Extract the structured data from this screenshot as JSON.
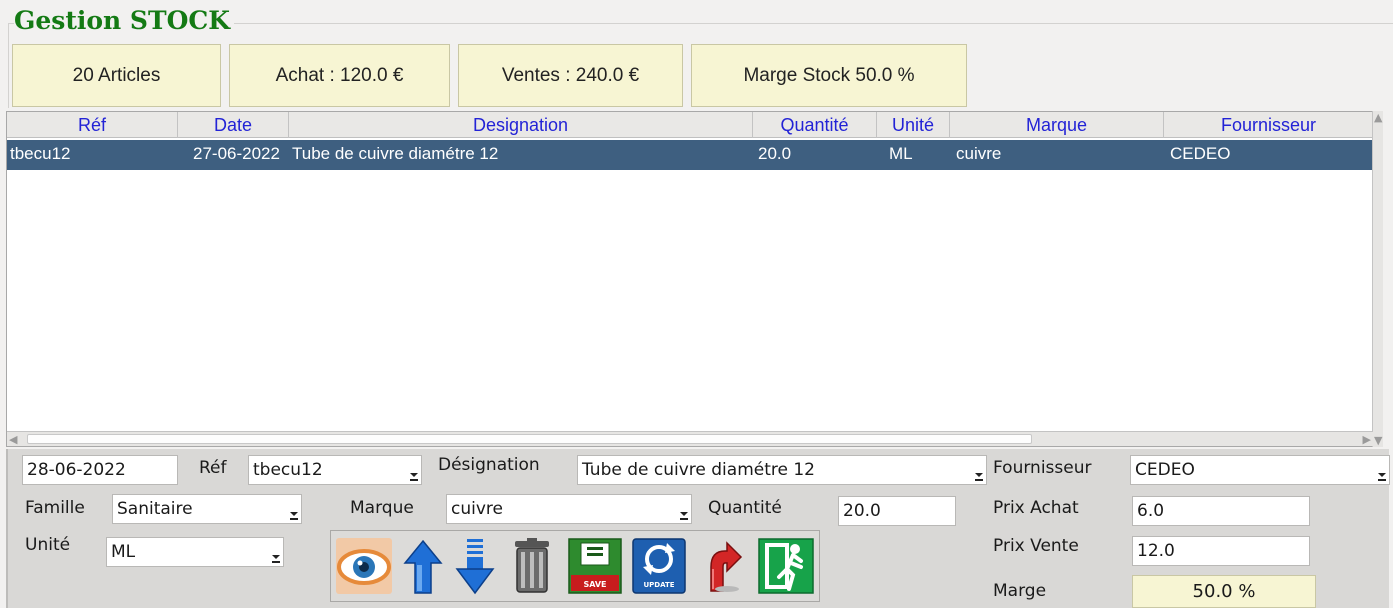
{
  "title": "Gestion STOCK",
  "stats": {
    "articles": "20 Articles",
    "achat": "Achat : 120.0 €",
    "ventes": "Ventes : 240.0 €",
    "marge": "Marge Stock 50.0 %"
  },
  "table": {
    "columns": [
      "Réf",
      "Date",
      "Designation",
      "Quantité",
      "Unité",
      "Marque",
      "Fournisseur"
    ],
    "rows": [
      {
        "ref": "tbecu12",
        "date": "27-06-2022",
        "designation": "Tube de cuivre diamétre 12",
        "quantite": "20.0",
        "unite": "ML",
        "marque": "cuivre",
        "fournisseur": "CEDEO"
      }
    ]
  },
  "form": {
    "date": "28-06-2022",
    "ref_label": "Réf",
    "ref": "tbecu12",
    "designation_label": "Désignation",
    "designation": "Tube de cuivre diamétre 12",
    "fournisseur_label": "Fournisseur",
    "fournisseur": "CEDEO",
    "famille_label": "Famille",
    "famille": "Sanitaire",
    "marque_label": "Marque",
    "marque": "cuivre",
    "quantite_label": "Quantité",
    "quantite": "20.0",
    "prix_achat_label": "Prix Achat",
    "prix_achat": "6.0",
    "unite_label": "Unité",
    "unite": "ML",
    "prix_vente_label": "Prix Vente",
    "prix_vente": "12.0",
    "marge_label": "Marge",
    "marge": "50.0 %"
  },
  "toolbar": {
    "save_caption": "SAVE",
    "update_caption": "UPDATE",
    "icons": [
      "eye-icon",
      "arrow-up-icon",
      "arrow-down-icon",
      "trash-icon",
      "save-icon",
      "update-icon",
      "undo-icon",
      "exit-icon"
    ]
  },
  "colors": {
    "title": "#147a14",
    "header_text": "#2323d6",
    "selected_row": "#3e5f80",
    "stat_bg": "#f7f5d3"
  }
}
